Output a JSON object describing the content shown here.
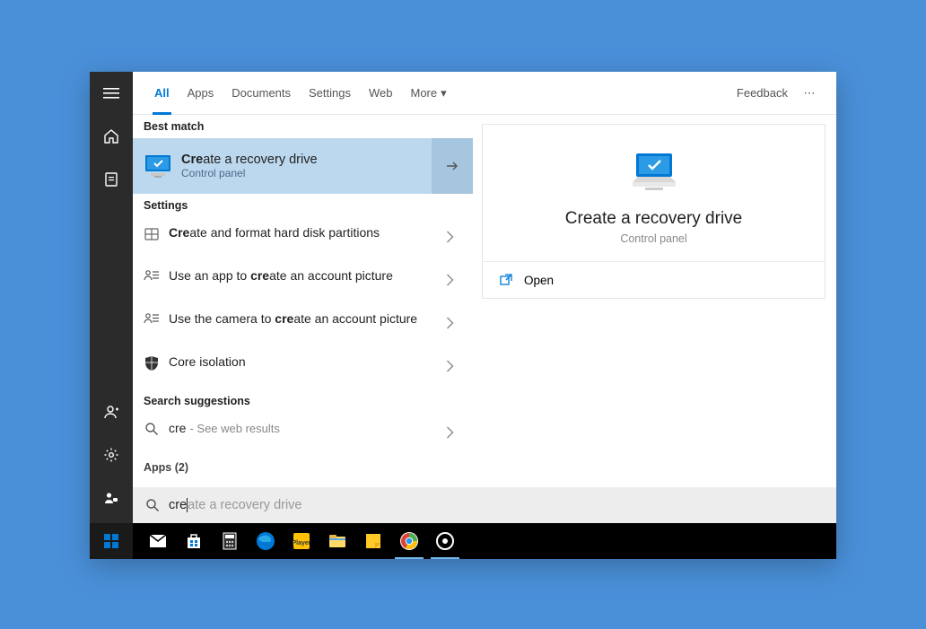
{
  "tabs": {
    "all": "All",
    "apps": "Apps",
    "documents": "Documents",
    "settings": "Settings",
    "web": "Web",
    "more": "More"
  },
  "header": {
    "feedback": "Feedback"
  },
  "sections": {
    "best_match": "Best match",
    "settings": "Settings",
    "search_suggestions": "Search suggestions",
    "apps": "Apps (2)"
  },
  "best_match": {
    "title_pre": "Cre",
    "title_post": "ate a recovery drive",
    "subtitle": "Control panel"
  },
  "settings_items": [
    {
      "pre": "Cre",
      "post": "ate and format hard disk partitions",
      "icon": "disk"
    },
    {
      "text_a": "Use an app to ",
      "bold": "cre",
      "text_b": "ate an account picture",
      "icon": "account"
    },
    {
      "text_a": "Use the camera to ",
      "bold": "cre",
      "text_b": "ate an account picture",
      "icon": "account"
    },
    {
      "text_a": "Co",
      "bold": "re",
      "text_b": " isolation",
      "plain": "Core isolation",
      "icon": "shield"
    }
  ],
  "suggestion": {
    "query": "cre",
    "hint": "- See web results"
  },
  "detail": {
    "title": "Create a recovery drive",
    "subtitle": "Control panel",
    "open": "Open"
  },
  "search": {
    "typed": "cre",
    "ghost": "ate a recovery drive"
  }
}
